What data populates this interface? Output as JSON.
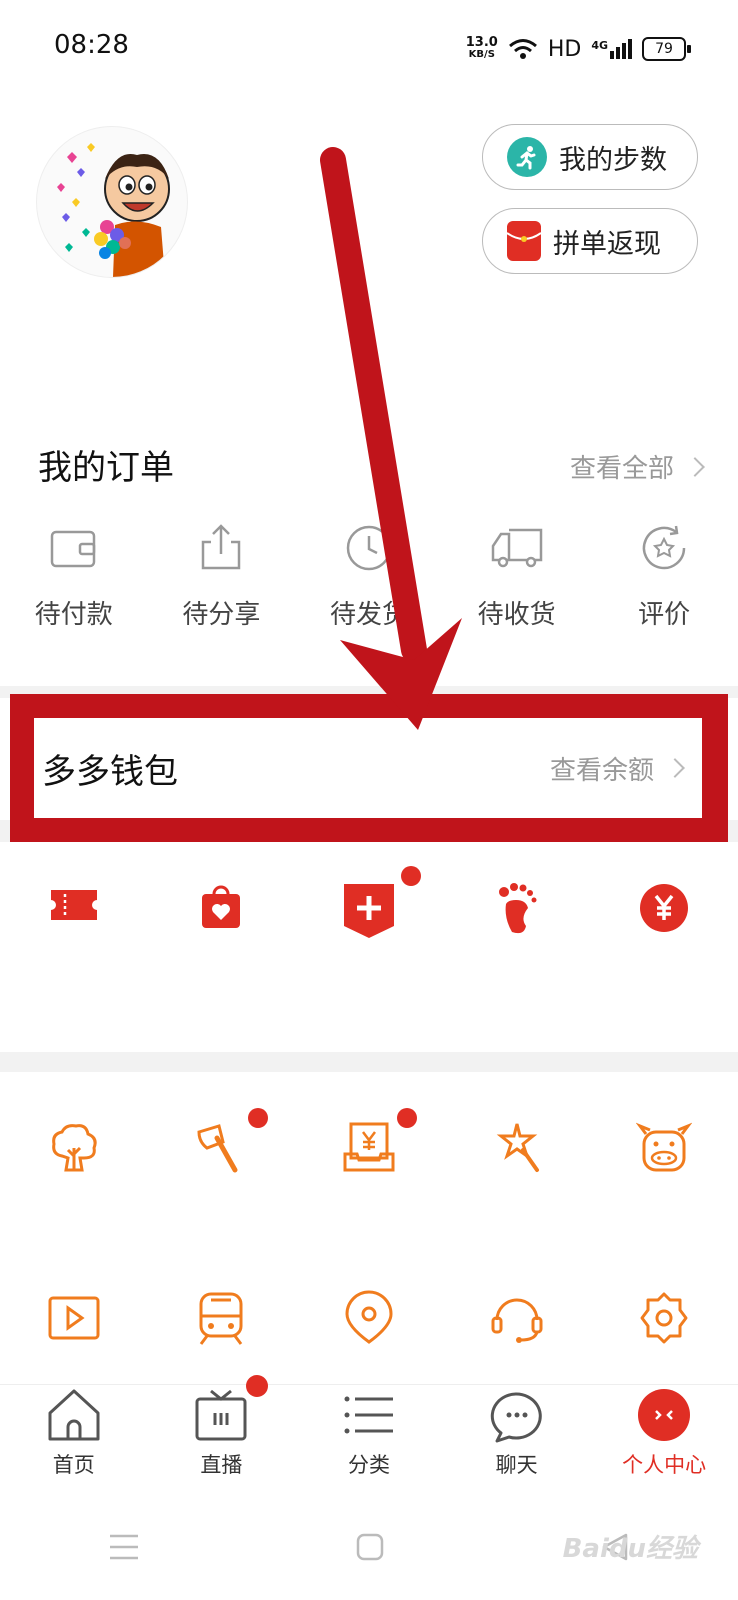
{
  "status_bar": {
    "time": "08:28",
    "speed_value": "13.0",
    "speed_unit": "KB/S",
    "network": "HD",
    "signal": "4G",
    "battery": "79"
  },
  "profile": {
    "buttons": [
      {
        "label": "我的步数",
        "icon": "running-person-icon",
        "color": "#2bb5a8"
      },
      {
        "label": "拼单返现",
        "icon": "red-envelope-icon",
        "color": "#e02e24"
      }
    ]
  },
  "orders": {
    "title": "我的订单",
    "view_all": "查看全部",
    "items": [
      {
        "label": "待付款",
        "icon": "wallet-icon"
      },
      {
        "label": "待分享",
        "icon": "share-icon"
      },
      {
        "label": "待发货",
        "icon": "clock-icon"
      },
      {
        "label": "待收货",
        "icon": "truck-icon"
      },
      {
        "label": "评价",
        "icon": "star-review-icon"
      }
    ]
  },
  "wallet": {
    "title": "多多钱包",
    "balance_link": "查看余额"
  },
  "red_icons": [
    "ticket-icon",
    "shopping-bag-icon",
    "medical-plus-icon",
    "footprint-icon",
    "yen-coin-icon"
  ],
  "orange_icons_row1": [
    "tree-icon",
    "axe-icon",
    "yen-card-icon",
    "magic-star-icon",
    "cow-icon"
  ],
  "orange_icons_row2": [
    "video-play-icon",
    "train-icon",
    "location-icon",
    "headset-icon",
    "settings-gear-icon"
  ],
  "bottom_nav": [
    {
      "label": "首页",
      "icon": "home-icon",
      "active": false
    },
    {
      "label": "直播",
      "icon": "tv-icon",
      "active": false
    },
    {
      "label": "分类",
      "icon": "list-icon",
      "active": false
    },
    {
      "label": "聊天",
      "icon": "chat-icon",
      "active": false
    },
    {
      "label": "个人中心",
      "icon": "profile-icon",
      "active": true
    }
  ],
  "watermark": "Baidu经验",
  "colors": {
    "brand_red": "#e02e24",
    "highlight_red": "#c0141b",
    "orange": "#f07c1e",
    "gray_text": "#999999"
  }
}
